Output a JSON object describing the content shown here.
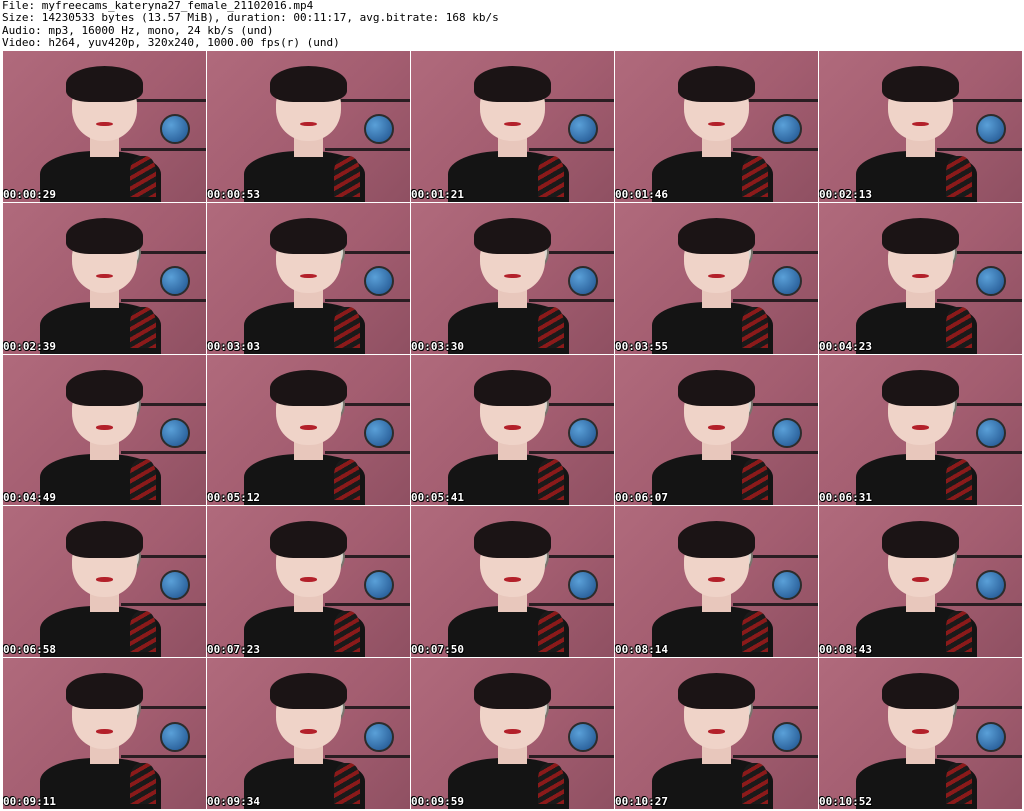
{
  "header": {
    "file_line": "File: myfreecams_kateryna27_female_21102016.mp4",
    "size_line": "Size: 14230533 bytes (13.57 MiB), duration: 00:11:17, avg.bitrate: 168 kb/s",
    "audio_line": "Audio: mp3, 16000 Hz, mono, 24 kb/s (und)",
    "video_line": "Video: h264, yuv420p, 320x240, 1000.00 fps(r) (und)"
  },
  "thumbnails": [
    {
      "timestamp": "00:00:29"
    },
    {
      "timestamp": "00:00:53"
    },
    {
      "timestamp": "00:01:21"
    },
    {
      "timestamp": "00:01:46"
    },
    {
      "timestamp": "00:02:13"
    },
    {
      "timestamp": "00:02:39"
    },
    {
      "timestamp": "00:03:03"
    },
    {
      "timestamp": "00:03:30"
    },
    {
      "timestamp": "00:03:55"
    },
    {
      "timestamp": "00:04:23"
    },
    {
      "timestamp": "00:04:49"
    },
    {
      "timestamp": "00:05:12"
    },
    {
      "timestamp": "00:05:41"
    },
    {
      "timestamp": "00:06:07"
    },
    {
      "timestamp": "00:06:31"
    },
    {
      "timestamp": "00:06:58"
    },
    {
      "timestamp": "00:07:23"
    },
    {
      "timestamp": "00:07:50"
    },
    {
      "timestamp": "00:08:14"
    },
    {
      "timestamp": "00:08:43"
    },
    {
      "timestamp": "00:09:11"
    },
    {
      "timestamp": "00:09:34"
    },
    {
      "timestamp": "00:09:59"
    },
    {
      "timestamp": "00:10:27"
    },
    {
      "timestamp": "00:10:52"
    }
  ],
  "colors": {
    "background": "#ffffff",
    "wall": "#a35d70",
    "timestamp_text": "#ffffff"
  }
}
